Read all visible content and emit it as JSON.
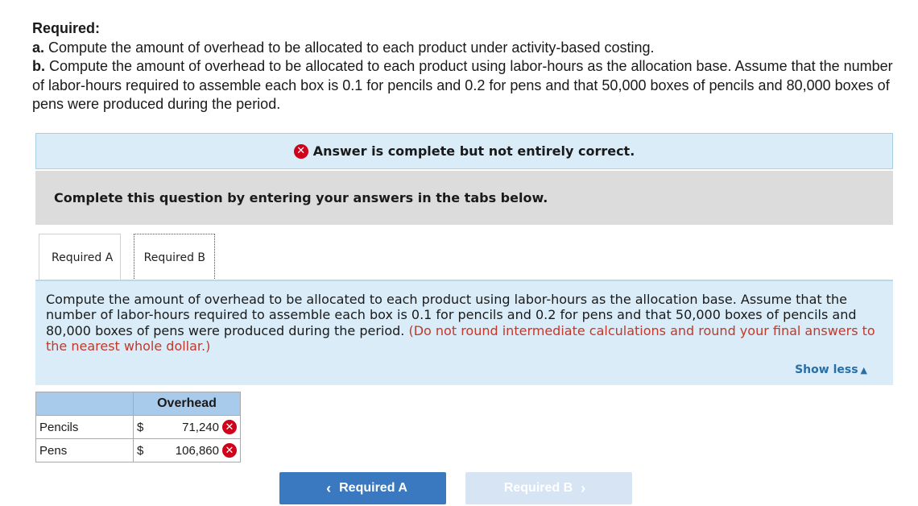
{
  "question": {
    "heading": "Required:",
    "a_label": "a.",
    "a_text": " Compute the amount of overhead to be allocated to each product under activity-based costing.",
    "b_label": "b.",
    "b_text": " Compute the amount of overhead to be allocated to each product using labor-hours as the allocation base. Assume that the number",
    "b_line2": "of labor-hours required to assemble each box is 0.1 for pencils and 0.2 for pens and that 50,000 boxes of pencils and 80,000 boxes of",
    "b_line3": "pens were produced during the period."
  },
  "banner": {
    "text": "Answer is complete but not entirely correct.",
    "icon": "x-icon",
    "color": "#d0021b"
  },
  "instruction": "Complete this question by entering your answers in the tabs below.",
  "tabs": [
    {
      "label": "Required A"
    },
    {
      "label": "Required B"
    }
  ],
  "panel": {
    "text": "Compute the amount of overhead to be allocated to each product using labor-hours as the allocation base. Assume that the number of labor-hours required to assemble each box is 0.1 for pencils and 0.2 for pens and that 50,000 boxes of pencils and 80,000 boxes of pens were produced during the period.",
    "note": "(Do not round intermediate calculations and round your final answers to the nearest whole dollar.)",
    "show_less": "Show less"
  },
  "table": {
    "header": "Overhead",
    "rows": [
      {
        "label": "Pencils",
        "currency": "$",
        "value": "71,240",
        "status": "incorrect"
      },
      {
        "label": "Pens",
        "currency": "$",
        "value": "106,860",
        "status": "incorrect"
      }
    ]
  },
  "nav": {
    "prev_label": "Required A",
    "next_label": "Required B"
  },
  "colors": {
    "accent": "#3a78c0",
    "error": "#d0021b",
    "panel_bg": "#d9ecf8",
    "header_bg": "#a9cbeb"
  }
}
